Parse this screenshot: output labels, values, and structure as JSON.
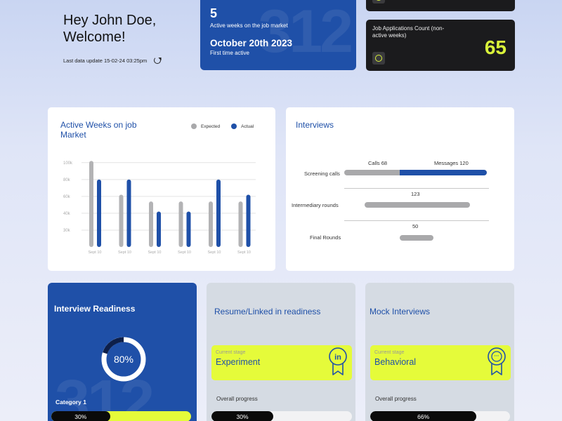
{
  "greeting": {
    "line1": "Hey John Doe,",
    "line2": "Welcome!",
    "last_update": "Last data update 15-02-24 03:25pm"
  },
  "active_card": {
    "weeks": "5",
    "weeks_label": "Active weeks on the job market",
    "date": "October 20th 2023",
    "date_label": "First time active",
    "watermark": "312"
  },
  "applications_card": {
    "label": "Job Applications Count (non-active weeks)",
    "value": "65"
  },
  "weeks_panel": {
    "title": "Active Weeks on job Market",
    "legend_expected": "Expected",
    "legend_actual": "Actual"
  },
  "chart_data": {
    "type": "bar",
    "title": "Active Weeks on job Market",
    "categories": [
      "Sept 10",
      "Sept 10",
      "Sept 10",
      "Sept 10",
      "Sept 10",
      "Sept 10"
    ],
    "series": [
      {
        "name": "Expected",
        "values": [
          102,
          62,
          54,
          54,
          54,
          54
        ],
        "color": "#b3b3b5"
      },
      {
        "name": "Actual",
        "values": [
          80,
          80,
          42,
          42,
          80,
          62
        ],
        "color": "#1f50a8"
      }
    ],
    "yticks": [
      "100k",
      "80k",
      "60k",
      "40k",
      "30k"
    ],
    "yticks_values": [
      100,
      80,
      60,
      40,
      20
    ],
    "ylim": [
      0,
      104
    ],
    "grid": true,
    "legend": "top-right"
  },
  "interviews": {
    "title": "Interviews",
    "rows": [
      {
        "label": "Screening calls",
        "calls": "Calls 68",
        "messages": "Messages 120"
      },
      {
        "label": "Intermediary rounds",
        "value": "123"
      },
      {
        "label": "Final Rounds",
        "value": "50"
      }
    ]
  },
  "readiness": {
    "title": "Interview Readiness",
    "percent_label": "80%",
    "percent": 80,
    "category": "Category 1",
    "category_progress_label": "30%",
    "category_progress": 0.42,
    "watermark": "312"
  },
  "resume": {
    "title": "Resume/Linked in readiness",
    "stage_label": "Current stage",
    "stage": "Experiment",
    "icon_text": "in",
    "overall_label": "Overall progress",
    "progress_label": "30%",
    "progress": 0.44
  },
  "mock": {
    "title": "Mock Interviews",
    "stage_label": "Current stage",
    "stage": "Behavioral",
    "icon_text": "···",
    "overall_label": "Overall progress",
    "progress_label": "66%",
    "progress": 0.76
  },
  "colors": {
    "primary": "#1f50a8",
    "accent": "#d9f23a",
    "highlight": "#e5fb3a",
    "dark": "#1b1b1d"
  }
}
